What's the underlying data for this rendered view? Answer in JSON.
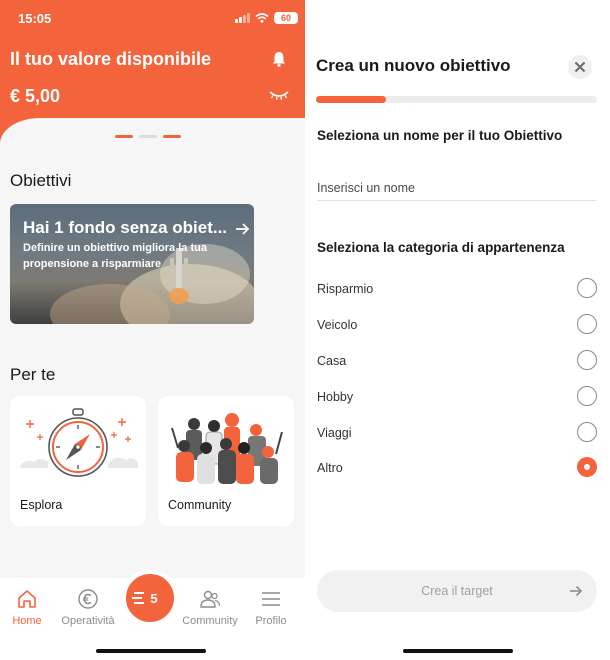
{
  "left": {
    "status": {
      "time": "15:05",
      "battery": "60"
    },
    "header": {
      "title": "Il tuo valore disponibile",
      "amount": "€ 5,00"
    },
    "goals_section": {
      "title": "Obiettivi",
      "card": {
        "title": "Hai 1 fondo senza obiet...",
        "description": "Definire un obiettivo migliora la tua propensione a risparmiare"
      }
    },
    "for_you": {
      "title": "Per te",
      "tiles": [
        {
          "label": "Esplora",
          "icon": "compass-icon"
        },
        {
          "label": "Community",
          "icon": "people-illustration"
        }
      ]
    },
    "tabbar": {
      "items": [
        {
          "label": "Home",
          "icon": "home-icon",
          "active": true
        },
        {
          "label": "Operatività",
          "icon": "euro-icon",
          "active": false
        },
        {
          "label": "Community",
          "icon": "people-icon",
          "active": false
        },
        {
          "label": "Profilo",
          "icon": "menu-icon",
          "active": false
        }
      ],
      "center_badge": "5"
    },
    "pager": {
      "count": 3,
      "active_index": 0
    }
  },
  "right": {
    "title": "Crea un nuovo obiettivo",
    "progress": 0.25,
    "name_section": {
      "label": "Seleziona un nome per il tuo Obiettivo",
      "placeholder": "Inserisci un nome",
      "value": ""
    },
    "category_section": {
      "label": "Seleziona la categoria di appartenenza",
      "options": [
        {
          "label": "Risparmio",
          "selected": false
        },
        {
          "label": "Veicolo",
          "selected": false
        },
        {
          "label": "Casa",
          "selected": false
        },
        {
          "label": "Hobby",
          "selected": false
        },
        {
          "label": "Viaggi",
          "selected": false
        },
        {
          "label": "Altro",
          "selected": true
        }
      ]
    },
    "submit": {
      "label": "Crea il target",
      "enabled": false
    }
  },
  "colors": {
    "accent": "#f4643c",
    "background": "#f6f6f6",
    "disabled_button": "#f1f1f1"
  }
}
